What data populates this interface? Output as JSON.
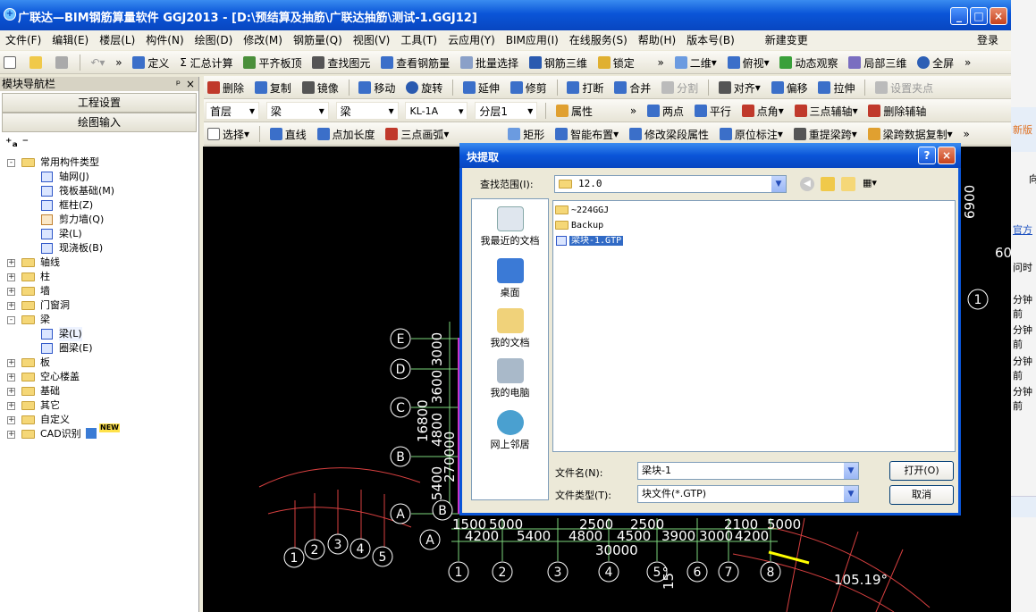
{
  "title": "广联达—BIM钢筋算量软件 GGJ2013 - [D:\\预结算及抽筋\\广联达抽筋\\测试-1.GGJ12]",
  "window_buttons": [
    "_",
    "□",
    "×"
  ],
  "menu": [
    "文件(F)",
    "编辑(E)",
    "楼层(L)",
    "构件(N)",
    "绘图(D)",
    "修改(M)",
    "钢筋量(Q)",
    "视图(V)",
    "工具(T)",
    "云应用(Y)",
    "BIM应用(I)",
    "在线服务(S)",
    "帮助(H)",
    "版本号(B)",
    "新建变更",
    "登录"
  ],
  "toolbar1": {
    "more": "»",
    "items": [
      "定义",
      "汇总计算",
      "平齐板顶",
      "查找图元",
      "查看钢筋量",
      "批量选择",
      "钢筋三维",
      "锁定"
    ],
    "items2": [
      "二维",
      "俯视",
      "动态观察",
      "局部三维",
      "全屏"
    ]
  },
  "left_panel": {
    "title": "模块导航栏",
    "pin": "ᵖ",
    "close": "×",
    "btn_settings": "工程设置",
    "btn_drawing": "绘图输入",
    "tree": [
      {
        "label": "常用构件类型",
        "level": 0,
        "expand": "-",
        "type": "folder"
      },
      {
        "label": "轴网(J)",
        "level": 1,
        "type": "leaf"
      },
      {
        "label": "筏板基础(M)",
        "level": 1,
        "type": "leaf"
      },
      {
        "label": "框柱(Z)",
        "level": 1,
        "type": "leaf"
      },
      {
        "label": "剪力墙(Q)",
        "level": 1,
        "type": "leaf"
      },
      {
        "label": "梁(L)",
        "level": 1,
        "type": "leaf"
      },
      {
        "label": "现浇板(B)",
        "level": 1,
        "type": "leaf"
      },
      {
        "label": "轴线",
        "level": 0,
        "expand": "+",
        "type": "folder"
      },
      {
        "label": "柱",
        "level": 0,
        "expand": "+",
        "type": "folder"
      },
      {
        "label": "墙",
        "level": 0,
        "expand": "+",
        "type": "folder"
      },
      {
        "label": "门窗洞",
        "level": 0,
        "expand": "+",
        "type": "folder"
      },
      {
        "label": "梁",
        "level": 0,
        "expand": "-",
        "type": "folder"
      },
      {
        "label": "梁(L)",
        "level": 1,
        "type": "leaf"
      },
      {
        "label": "圈梁(E)",
        "level": 1,
        "type": "leaf"
      },
      {
        "label": "板",
        "level": 0,
        "expand": "+",
        "type": "folder"
      },
      {
        "label": "空心楼盖",
        "level": 0,
        "expand": "+",
        "type": "folder"
      },
      {
        "label": "基础",
        "level": 0,
        "expand": "+",
        "type": "folder"
      },
      {
        "label": "其它",
        "level": 0,
        "expand": "+",
        "type": "folder"
      },
      {
        "label": "自定义",
        "level": 0,
        "expand": "+",
        "type": "folder"
      },
      {
        "label": "CAD识别",
        "level": 0,
        "expand": "+",
        "type": "folder"
      }
    ],
    "new_badge": "NEW"
  },
  "toolbar2": {
    "more": "»",
    "items": [
      "删除",
      "复制",
      "镜像",
      "移动",
      "旋转",
      "延伸",
      "修剪",
      "打断",
      "合并",
      "分割",
      "对齐",
      "偏移",
      "拉伸",
      "设置夹点"
    ]
  },
  "toolbar3": {
    "floor": "首层",
    "type1": "梁",
    "type2": "梁",
    "name": "KL-1A",
    "layer": "分层1",
    "properties": "属性",
    "more": "»",
    "items": [
      "两点",
      "平行",
      "点角",
      "三点辅轴",
      "删除辅轴"
    ]
  },
  "toolbar4": {
    "more": "»",
    "items": [
      "选择",
      "直线",
      "点加长度",
      "三点画弧",
      "矩形",
      "智能布置",
      "修改梁段属性",
      "原位标注",
      "重提梁跨",
      "梁跨数据复制"
    ]
  },
  "dialog": {
    "title": "块提取",
    "help": "?",
    "close": "×",
    "look_in_label": "查找范围(I):",
    "look_in_value": "12.0",
    "places": [
      "我最近的文档",
      "桌面",
      "我的文档",
      "我的电脑",
      "网上邻居"
    ],
    "files": [
      "~224GGJ",
      "Backup",
      "梁块-1.GTP"
    ],
    "selected_file": "梁块-1.GTP",
    "filename_label": "文件名(N):",
    "filename_value": "梁块-1",
    "filetype_label": "文件类型(T):",
    "filetype_value": "块文件(*.GTP)",
    "open": "打开(O)",
    "cancel": "取消"
  },
  "right_strip": [
    "新版",
    "向",
    "官方",
    "问时",
    "分钟前",
    "分钟前",
    "分钟前",
    "分钟前"
  ],
  "canvas": {
    "axes_left": [
      "E",
      "D",
      "C",
      "B",
      "A"
    ],
    "axes_bottom": [
      "1",
      "2",
      "3",
      "4",
      "5",
      "6",
      "7",
      "8"
    ],
    "arc_axes": [
      "1",
      "2",
      "3",
      "4",
      "5",
      "A",
      "B"
    ],
    "dims_vertical": [
      "3000",
      "3600",
      "4800",
      "16800",
      "270000",
      "5400"
    ],
    "dims_bottom": [
      "1500",
      "5000",
      "4200",
      "5400",
      "2500",
      "2500",
      "4800",
      "4500",
      "3900",
      "3000",
      "4200",
      "2100",
      "5000",
      "30000"
    ],
    "angle1": "105.19°",
    "angle2": "15°",
    "right_labels": [
      "6900",
      "60",
      "1"
    ],
    "colors": {
      "axis_green": "#7cd67c",
      "text_white": "#ffffff",
      "arc_red": "#ff4040",
      "beam_magenta": "#cc33cc",
      "highlight": "#ffff00"
    }
  }
}
